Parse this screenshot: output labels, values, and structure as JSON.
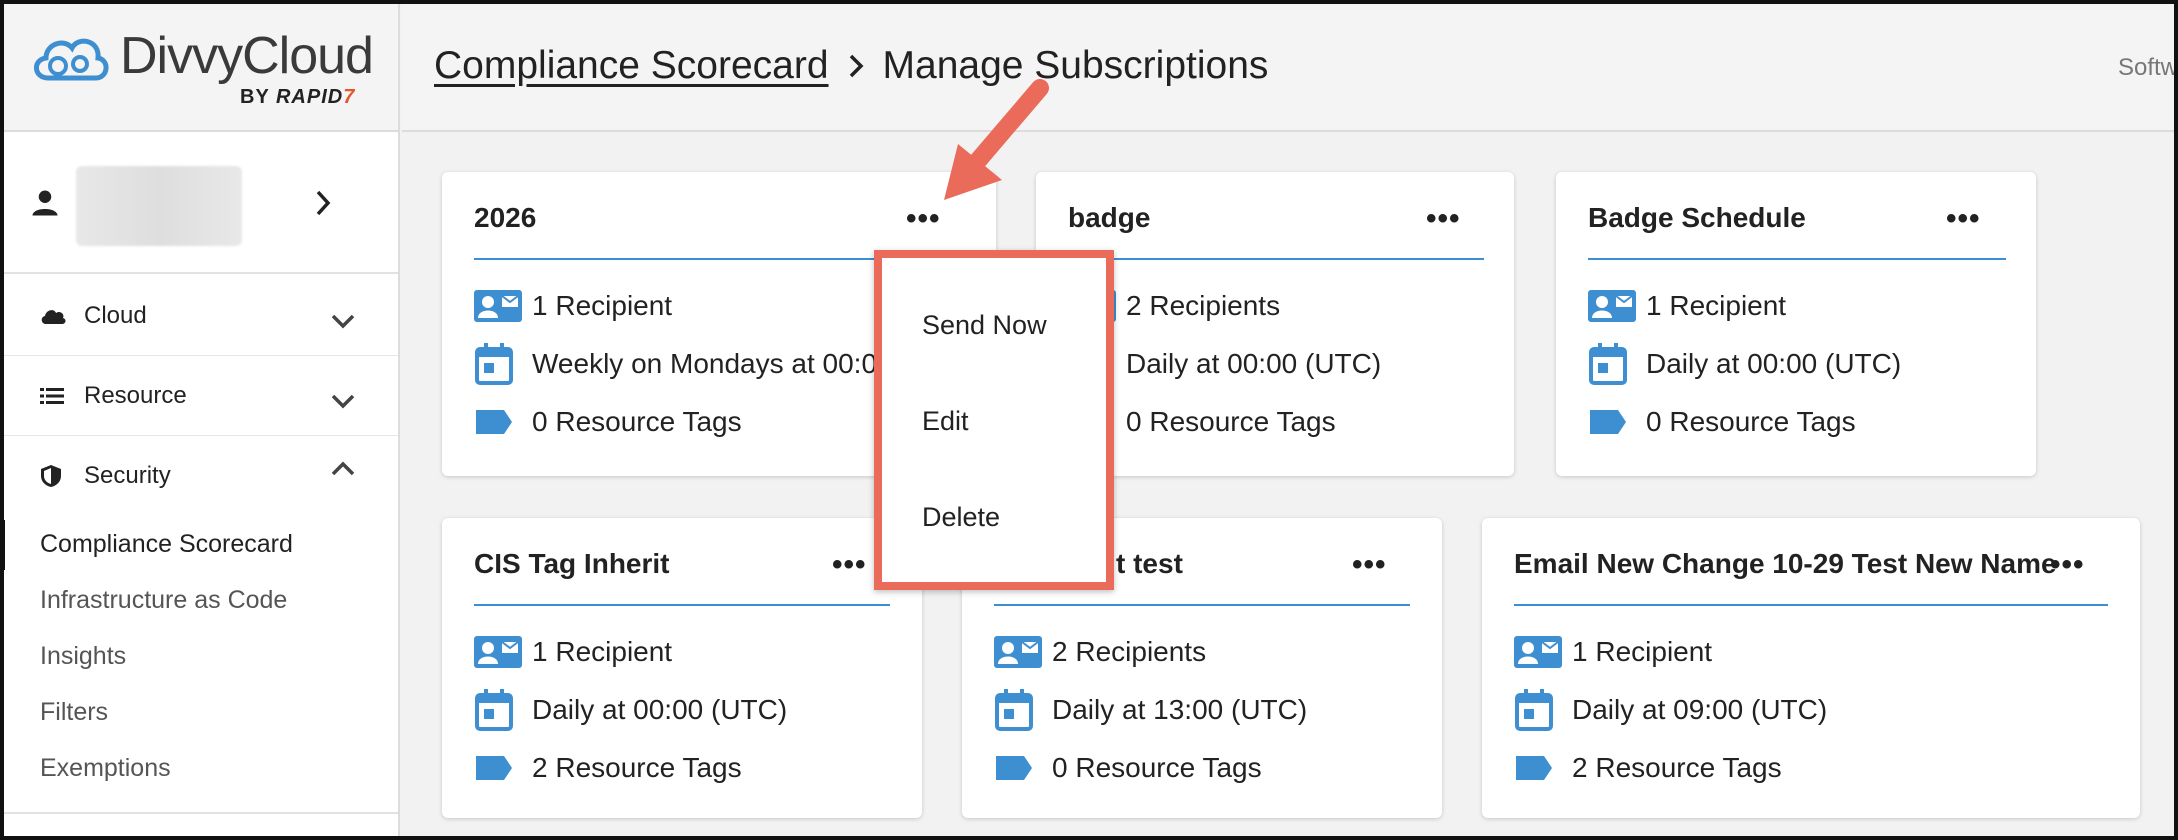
{
  "brand": {
    "name": "DivvyCloud",
    "by": "BY",
    "rapid": "RAPID",
    "seven": "7"
  },
  "header": {
    "breadcrumb_link": "Compliance Scorecard",
    "breadcrumb_current": "Manage Subscriptions",
    "right_text": "Softw"
  },
  "sidebar": {
    "nav": [
      {
        "label": "Cloud",
        "icon": "cloud-icon",
        "expanded": false
      },
      {
        "label": "Resource",
        "icon": "list-icon",
        "expanded": false
      },
      {
        "label": "Security",
        "icon": "shield-icon",
        "expanded": true
      }
    ],
    "security_items": [
      "Compliance Scorecard",
      "Infrastructure as Code",
      "Insights",
      "Filters",
      "Exemptions"
    ],
    "active_item": "Compliance Scorecard"
  },
  "cards": [
    {
      "title": "2026",
      "recipients": "1 Recipient",
      "schedule": "Weekly on Mondays at 00:00",
      "tags": "0 Resource Tags"
    },
    {
      "title": "badge",
      "recipients": "2 Recipients",
      "schedule": "Daily at 00:00 (UTC)",
      "tags": "0 Resource Tags"
    },
    {
      "title": "Badge Schedule",
      "recipients": "1 Recipient",
      "schedule": "Daily at 00:00 (UTC)",
      "tags": "0 Resource Tags"
    },
    {
      "title": "CIS Tag Inherit",
      "recipients": "1 Recipient",
      "schedule": "Daily at 00:00 (UTC)",
      "tags": "2 Resource Tags"
    },
    {
      "title": "t test",
      "recipients": "2 Recipients",
      "schedule": "Daily at 13:00 (UTC)",
      "tags": "0 Resource Tags"
    },
    {
      "title": "Email New Change 10-29 Test New Name",
      "recipients": "1 Recipient",
      "schedule": "Daily at 09:00 (UTC)",
      "tags": "2 Resource Tags"
    }
  ],
  "card_menu_glyph": "•••",
  "dropdown": {
    "items": [
      "Send Now",
      "Edit",
      "Delete"
    ]
  },
  "colors": {
    "accent_blue": "#3d8fd1",
    "highlight": "#ea6b5a"
  }
}
